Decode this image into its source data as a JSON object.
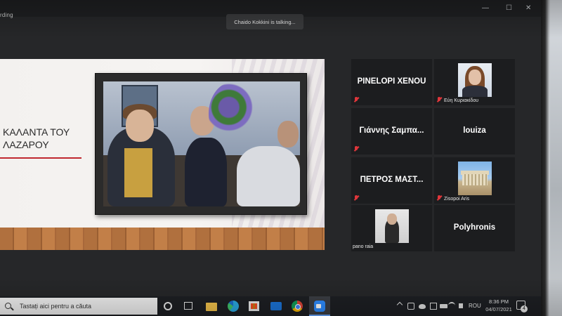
{
  "window": {
    "title_fragment": "rding",
    "recording_label": "ording",
    "talking_indicator": "Chaido Kokkini is talking..."
  },
  "slide": {
    "title": "ΚΑΛΑΝΤΑ ΤΟΥ ΛΑΖΑΡΟΥ",
    "accent_color": "#c0282f"
  },
  "gallery": {
    "tiles": [
      {
        "name": "PINELOPI XENOU",
        "muted": true,
        "has_video": false
      },
      {
        "name": "Εύη Κυριακίδου",
        "muted": true,
        "has_video": true
      },
      {
        "name": "Γιάννης Σαμπα...",
        "muted": true,
        "has_video": false
      },
      {
        "name": "louiza",
        "muted": false,
        "has_video": false
      },
      {
        "name": "ΠΕΤΡΟΣ ΜΑΣΤ...",
        "muted": true,
        "has_video": false
      },
      {
        "name": "Zisopoi Aris",
        "muted": true,
        "has_video": true
      },
      {
        "name": "pano raia",
        "muted": false,
        "has_video": true
      },
      {
        "name": "Polyhronis",
        "muted": false,
        "has_video": false
      }
    ]
  },
  "taskbar": {
    "search_placeholder": "Tastați aici pentru a căuta",
    "language": "ROU",
    "time": "8:36 PM",
    "date": "04/07/2021",
    "notification_count": "4",
    "pinned": [
      "task-view",
      "widgets",
      "file-explorer",
      "edge",
      "microsoft-store",
      "mail",
      "chrome",
      "zoom"
    ]
  }
}
